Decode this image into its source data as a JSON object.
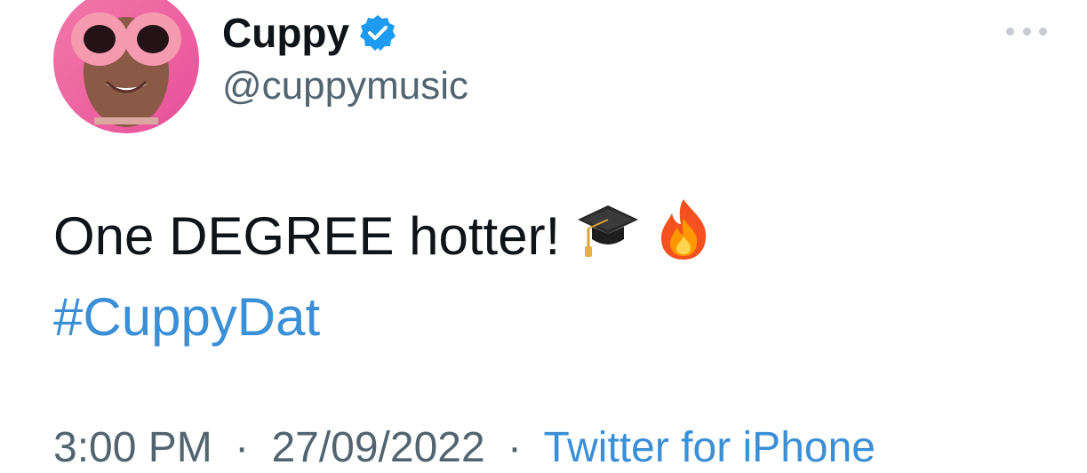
{
  "user": {
    "display_name": "Cuppy",
    "handle": "@cuppymusic",
    "verified": true
  },
  "tweet": {
    "text": "One DEGREE hotter!",
    "emojis": [
      "graduation-cap-emoji",
      "fire-emoji"
    ],
    "hashtag": "#CuppyDat"
  },
  "meta": {
    "time": "3:00 PM",
    "separator": "·",
    "date": "27/09/2022",
    "source": "Twitter for iPhone"
  },
  "colors": {
    "text": "#0f1419",
    "secondary": "#536471",
    "link": "#3b8fd6",
    "verified": "#1d9bf0"
  }
}
